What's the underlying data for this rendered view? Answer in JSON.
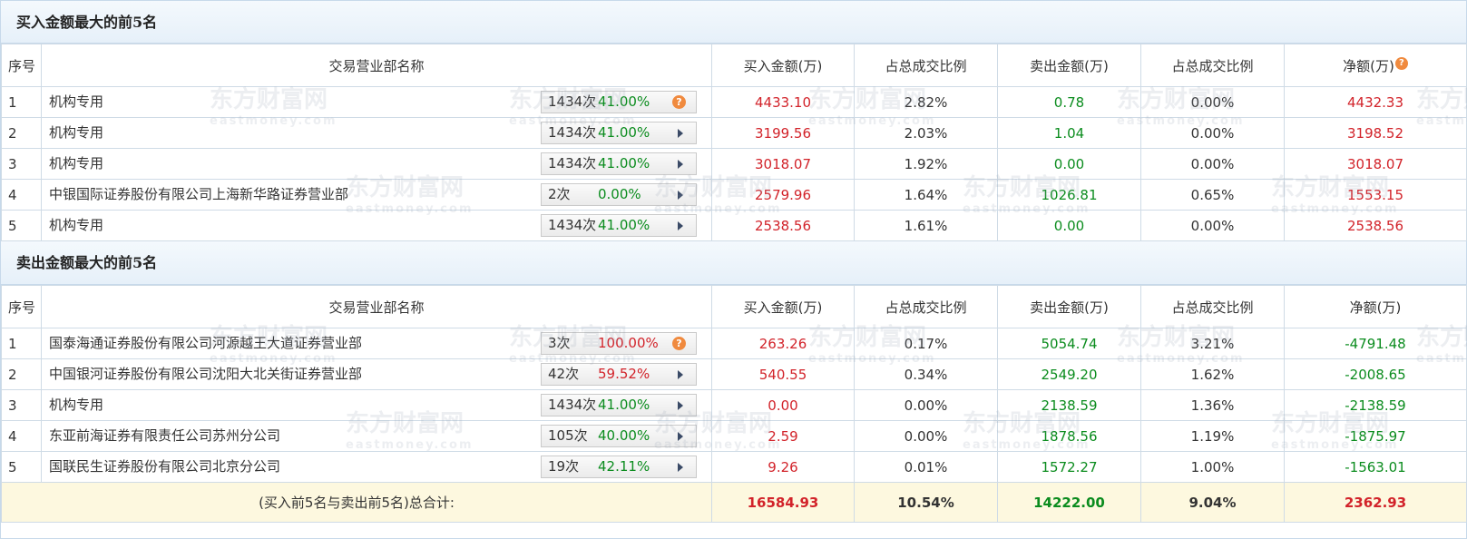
{
  "buy_section": {
    "title": "买入金额最大的前5名",
    "headers": [
      "序号",
      "交易营业部名称",
      "买入金额(万)",
      "占总成交比例",
      "卖出金额(万)",
      "占总成交比例",
      "净额(万)"
    ],
    "rows": [
      {
        "idx": "1",
        "name": "机构专用",
        "count": "1434次",
        "pct": "41.00%",
        "icon": "question-icon",
        "buy": "4433.10",
        "buy_ratio": "2.82%",
        "sell": "0.78",
        "sell_ratio": "0.00%",
        "net": "4432.33"
      },
      {
        "idx": "2",
        "name": "机构专用",
        "count": "1434次",
        "pct": "41.00%",
        "icon": "arrow-right-icon",
        "buy": "3199.56",
        "buy_ratio": "2.03%",
        "sell": "1.04",
        "sell_ratio": "0.00%",
        "net": "3198.52"
      },
      {
        "idx": "3",
        "name": "机构专用",
        "count": "1434次",
        "pct": "41.00%",
        "icon": "arrow-right-icon",
        "buy": "3018.07",
        "buy_ratio": "1.92%",
        "sell": "0.00",
        "sell_ratio": "0.00%",
        "net": "3018.07"
      },
      {
        "idx": "4",
        "name": "中银国际证券股份有限公司上海新华路证券营业部",
        "count": "2次",
        "pct": "0.00%",
        "icon": "arrow-right-icon",
        "buy": "2579.96",
        "buy_ratio": "1.64%",
        "sell": "1026.81",
        "sell_ratio": "0.65%",
        "net": "1553.15"
      },
      {
        "idx": "5",
        "name": "机构专用",
        "count": "1434次",
        "pct": "41.00%",
        "icon": "arrow-right-icon",
        "buy": "2538.56",
        "buy_ratio": "1.61%",
        "sell": "0.00",
        "sell_ratio": "0.00%",
        "net": "2538.56"
      }
    ]
  },
  "sell_section": {
    "title": "卖出金额最大的前5名",
    "headers": [
      "序号",
      "交易营业部名称",
      "买入金额(万)",
      "占总成交比例",
      "卖出金额(万)",
      "占总成交比例",
      "净额(万)"
    ],
    "rows": [
      {
        "idx": "1",
        "name": "国泰海通证券股份有限公司河源越王大道证券营业部",
        "count": "3次",
        "pct": "100.00%",
        "pct_color": "red",
        "icon": "question-icon",
        "buy": "263.26",
        "buy_ratio": "0.17%",
        "sell": "5054.74",
        "sell_ratio": "3.21%",
        "net": "-4791.48"
      },
      {
        "idx": "2",
        "name": "中国银河证券股份有限公司沈阳大北关街证券营业部",
        "count": "42次",
        "pct": "59.52%",
        "pct_color": "red",
        "icon": "arrow-right-icon",
        "buy": "540.55",
        "buy_ratio": "0.34%",
        "sell": "2549.20",
        "sell_ratio": "1.62%",
        "net": "-2008.65"
      },
      {
        "idx": "3",
        "name": "机构专用",
        "count": "1434次",
        "pct": "41.00%",
        "pct_color": "green",
        "icon": "arrow-right-icon",
        "buy": "0.00",
        "buy_ratio": "0.00%",
        "sell": "2138.59",
        "sell_ratio": "1.36%",
        "net": "-2138.59"
      },
      {
        "idx": "4",
        "name": "东亚前海证券有限责任公司苏州分公司",
        "count": "105次",
        "pct": "40.00%",
        "pct_color": "green",
        "icon": "arrow-right-icon",
        "buy": "2.59",
        "buy_ratio": "0.00%",
        "sell": "1878.56",
        "sell_ratio": "1.19%",
        "net": "-1875.97"
      },
      {
        "idx": "5",
        "name": "国联民生证券股份有限公司北京分公司",
        "count": "19次",
        "pct": "42.11%",
        "pct_color": "green",
        "icon": "arrow-right-icon",
        "buy": "9.26",
        "buy_ratio": "0.01%",
        "sell": "1572.27",
        "sell_ratio": "1.00%",
        "net": "-1563.01"
      }
    ]
  },
  "total": {
    "label": "(买入前5名与卖出前5名)总合计:",
    "buy": "16584.93",
    "buy_ratio": "10.54%",
    "sell": "14222.00",
    "sell_ratio": "9.04%",
    "net": "2362.93"
  },
  "watermark": {
    "cn": "东方财富网",
    "en": "eastmoney.com"
  },
  "colors": {
    "buy": "#d2232a",
    "sell": "#0b8c1e",
    "badge_green": "#0b8c1e",
    "badge_red": "#d2232a",
    "total_bg": "#fdf8df",
    "header_bg": "#e6f0f9",
    "icon_orange": "#f08a3e"
  }
}
